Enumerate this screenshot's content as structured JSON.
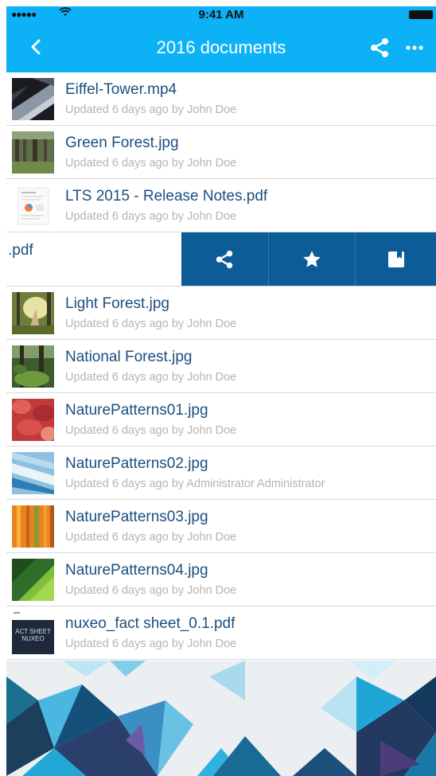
{
  "status_bar": {
    "signal": "●●●●●",
    "time": "9:41 AM"
  },
  "nav": {
    "title": "2016 documents"
  },
  "colors": {
    "accent": "#0db1f5",
    "action_bg": "#0c5c98",
    "title_text": "#1b4f7f",
    "subtitle_text": "#b4b4b4"
  },
  "files": [
    {
      "name": "Eiffel-Tower.mp4",
      "meta": "Updated 6 days ago by John Doe",
      "thumb": "eiffel"
    },
    {
      "name": "Green Forest.jpg",
      "meta": "Updated 6 days ago by John Doe",
      "thumb": "green-forest"
    },
    {
      "name": "LTS 2015 - Release Notes.pdf",
      "meta": "Updated 6 days ago by John Doe",
      "thumb": "pdf-doc"
    },
    {
      "name": ".pdf",
      "swiped": true
    },
    {
      "name": "Light Forest.jpg",
      "meta": "Updated 6 days ago by John Doe",
      "thumb": "light-forest"
    },
    {
      "name": "National Forest.jpg",
      "meta": "Updated 6 days ago by John Doe",
      "thumb": "national-forest"
    },
    {
      "name": "NaturePatterns01.jpg",
      "meta": "Updated 6 days ago by John Doe",
      "thumb": "pattern-red"
    },
    {
      "name": "NaturePatterns02.jpg",
      "meta": "Updated 6 days ago by Administrator Administrator",
      "thumb": "pattern-ice"
    },
    {
      "name": "NaturePatterns03.jpg",
      "meta": "Updated 6 days ago by John Doe",
      "thumb": "pattern-orange"
    },
    {
      "name": "NaturePatterns04.jpg",
      "meta": "Updated 6 days ago by John Doe",
      "thumb": "pattern-leaf"
    },
    {
      "name": "nuxeo_fact sheet_0.1.pdf",
      "meta": "Updated 6 days ago by John Doe",
      "thumb": "nuxeo-factsheet"
    }
  ],
  "swipe_actions": [
    {
      "icon": "share-icon"
    },
    {
      "icon": "star-icon"
    },
    {
      "icon": "bookmark-icon"
    }
  ],
  "thumbnails": {
    "nuxeo_text": "ACT SHEET NUXEO"
  }
}
